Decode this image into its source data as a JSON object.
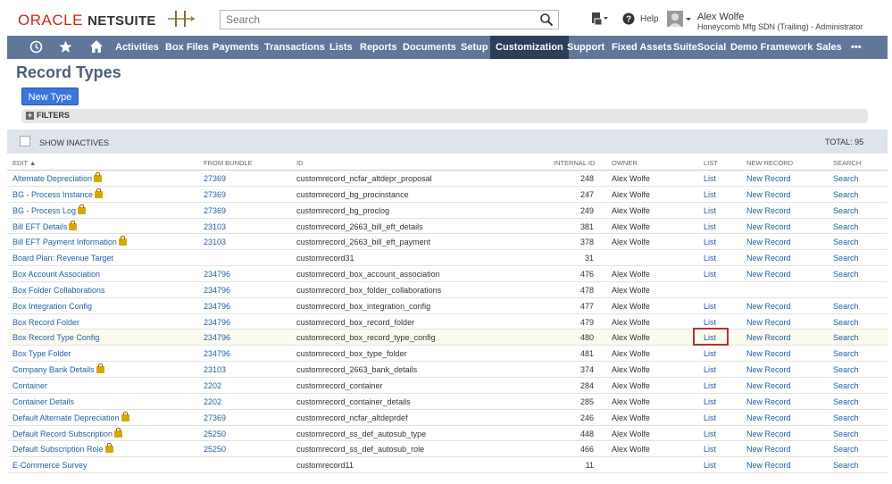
{
  "header": {
    "logo_oracle": "ORACLE",
    "logo_netsuite": "NETSUITE",
    "search_placeholder": "Search",
    "help_label": "Help",
    "user_name": "Alex Wolfe",
    "user_role": "Honeycomb Mfg SDN (Trailing) - Administrator"
  },
  "nav": {
    "items": [
      "Activities",
      "Box Files",
      "Payments",
      "Transactions",
      "Lists",
      "Reports",
      "Documents",
      "Setup",
      "Customization",
      "Support",
      "Fixed Assets",
      "SuiteSocial",
      "Demo Framework",
      "Sales"
    ],
    "active": "Customization",
    "more": "•••"
  },
  "page": {
    "title": "Record Types",
    "new_button": "New Type",
    "filters_label": "FILTERS",
    "show_inactives": "SHOW INACTIVES",
    "total": "TOTAL: 95"
  },
  "table": {
    "columns": [
      "EDIT ▲",
      "FROM BUNDLE",
      "ID",
      "INTERNAL ID",
      "OWNER",
      "LIST",
      "NEW RECORD",
      "SEARCH"
    ],
    "rows": [
      {
        "name": "Alternate Depreciation",
        "lock": true,
        "bundle": "27369",
        "id": "customrecord_ncfar_altdepr_proposal",
        "internal": "248",
        "owner": "Alex Wolfe",
        "list": "List",
        "new": "New Record",
        "search": "Search"
      },
      {
        "name": "BG - Process Instance",
        "lock": true,
        "bundle": "27369",
        "id": "customrecord_bg_procinstance",
        "internal": "247",
        "owner": "Alex Wolfe",
        "list": "List",
        "new": "New Record",
        "search": "Search"
      },
      {
        "name": "BG - Process Log",
        "lock": true,
        "bundle": "27369",
        "id": "customrecord_bg_proclog",
        "internal": "249",
        "owner": "Alex Wolfe",
        "list": "List",
        "new": "New Record",
        "search": "Search"
      },
      {
        "name": "Bill EFT Details",
        "lock": true,
        "bundle": "23103",
        "id": "customrecord_2663_bill_eft_details",
        "internal": "381",
        "owner": "Alex Wolfe",
        "list": "List",
        "new": "New Record",
        "search": "Search"
      },
      {
        "name": "Bill EFT Payment Information",
        "lock": true,
        "bundle": "23103",
        "id": "customrecord_2663_bill_eft_payment",
        "internal": "378",
        "owner": "Alex Wolfe",
        "list": "List",
        "new": "New Record",
        "search": "Search"
      },
      {
        "name": "Board Plan: Revenue Target",
        "lock": false,
        "bundle": "",
        "id": "customrecord31",
        "internal": "31",
        "owner": "",
        "list": "List",
        "new": "New Record",
        "search": "Search"
      },
      {
        "name": "Box Account Association",
        "lock": false,
        "bundle": "234796",
        "id": "customrecord_box_account_association",
        "internal": "476",
        "owner": "Alex Wolfe",
        "list": "List",
        "new": "New Record",
        "search": "Search"
      },
      {
        "name": "Box Folder Collaborations",
        "lock": false,
        "bundle": "234796",
        "id": "customrecord_box_folder_collaborations",
        "internal": "478",
        "owner": "Alex Wolfe",
        "list": "",
        "new": "",
        "search": ""
      },
      {
        "name": "Box Integration Config",
        "lock": false,
        "bundle": "234796",
        "id": "customrecord_box_integration_config",
        "internal": "477",
        "owner": "Alex Wolfe",
        "list": "List",
        "new": "New Record",
        "search": "Search"
      },
      {
        "name": "Box Record Folder",
        "lock": false,
        "bundle": "234796",
        "id": "customrecord_box_record_folder",
        "internal": "479",
        "owner": "Alex Wolfe",
        "list": "List",
        "new": "New Record",
        "search": "Search"
      },
      {
        "name": "Box Record Type Config",
        "lock": false,
        "bundle": "234796",
        "id": "customrecord_box_record_type_config",
        "internal": "480",
        "owner": "Alex Wolfe",
        "list": "List",
        "new": "New Record",
        "search": "Search",
        "highlight": true
      },
      {
        "name": "Box Type Folder",
        "lock": false,
        "bundle": "234796",
        "id": "customrecord_box_type_folder",
        "internal": "481",
        "owner": "Alex Wolfe",
        "list": "List",
        "new": "New Record",
        "search": "Search"
      },
      {
        "name": "Company Bank Details",
        "lock": true,
        "bundle": "23103",
        "id": "customrecord_2663_bank_details",
        "internal": "374",
        "owner": "Alex Wolfe",
        "list": "List",
        "new": "New Record",
        "search": "Search"
      },
      {
        "name": "Container",
        "lock": false,
        "bundle": "2202",
        "id": "customrecord_container",
        "internal": "284",
        "owner": "Alex Wolfe",
        "list": "List",
        "new": "New Record",
        "search": "Search"
      },
      {
        "name": "Container Details",
        "lock": false,
        "bundle": "2202",
        "id": "customrecord_container_details",
        "internal": "285",
        "owner": "Alex Wolfe",
        "list": "List",
        "new": "New Record",
        "search": "Search"
      },
      {
        "name": "Default Alternate Depreciation",
        "lock": true,
        "bundle": "27369",
        "id": "customrecord_ncfar_altdeprdef",
        "internal": "246",
        "owner": "Alex Wolfe",
        "list": "List",
        "new": "New Record",
        "search": "Search"
      },
      {
        "name": "Default Record Subscription",
        "lock": true,
        "bundle": "25250",
        "id": "customrecord_ss_def_autosub_type",
        "internal": "448",
        "owner": "Alex Wolfe",
        "list": "List",
        "new": "New Record",
        "search": "Search"
      },
      {
        "name": "Default Subscription Role",
        "lock": true,
        "bundle": "25250",
        "id": "customrecord_ss_def_autosub_role",
        "internal": "466",
        "owner": "Alex Wolfe",
        "list": "List",
        "new": "New Record",
        "search": "Search"
      },
      {
        "name": "E-Commerce Survey",
        "lock": false,
        "bundle": "",
        "id": "customrecord11",
        "internal": "11",
        "owner": "",
        "list": "List",
        "new": "New Record",
        "search": "Search"
      }
    ]
  },
  "colors": {
    "nav_bg": "#607799",
    "nav_active": "#2c3e58",
    "link": "#245ea8",
    "title": "#4d5f79",
    "button": "#3c74d9",
    "highlight_box": "#b8312f"
  }
}
